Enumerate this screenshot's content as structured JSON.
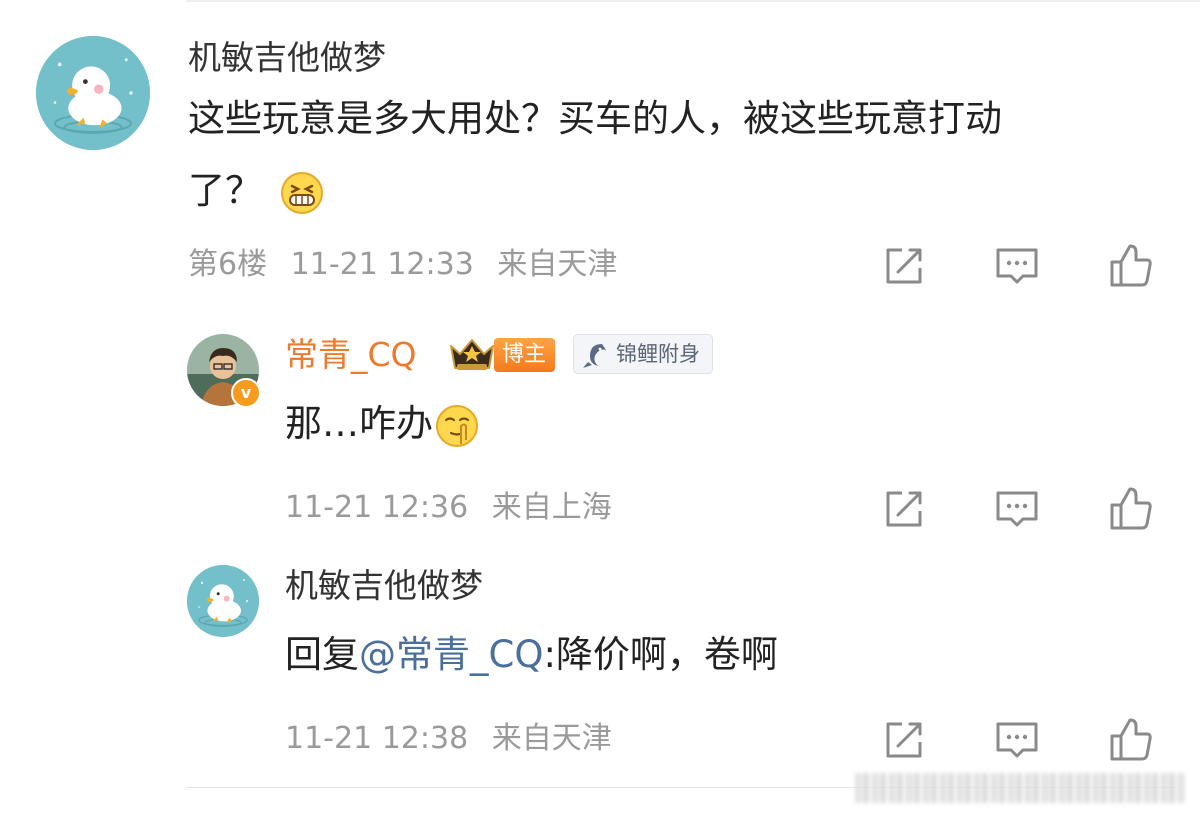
{
  "comment": {
    "username": "机敏吉他做梦",
    "text_line1": "这些玩意是多大用处？买车的人，被这些玩意打动",
    "text_line2": "了？",
    "floor": "第6楼",
    "time": "11-21 12:33",
    "location": "来自天津",
    "emoji": "grin-emoji"
  },
  "replies": [
    {
      "username": "常青_CQ",
      "badge_blogger": "博主",
      "badge_koi": "锦鲤附身",
      "text": "那…咋办",
      "emoji": "shush-emoji",
      "time": "11-21 12:36",
      "location": "来自上海",
      "verified_mark": "v"
    },
    {
      "username": "机敏吉他做梦",
      "text_prefix": "回复",
      "mention": "@常青_CQ",
      "text_rest": ":降价啊，卷啊",
      "time": "11-21 12:38",
      "location": "来自天津"
    }
  ],
  "icons": {
    "share": "share-icon",
    "comment": "comment-icon",
    "like": "thumbs-up-icon"
  },
  "colors": {
    "blogger_name": "#ee7a2d",
    "mention": "#4a6f9c",
    "meta": "#9a9a9a",
    "duck_avatar_bg": "#73bfca"
  }
}
